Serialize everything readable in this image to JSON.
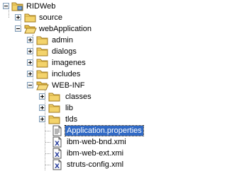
{
  "tree": {
    "root": {
      "label": "RIDWeb",
      "expanded": true,
      "icon": "project-folder-icon"
    },
    "nodes": [
      {
        "label": "source",
        "expanded": false,
        "icon": "folder-icon"
      },
      {
        "label": "webApplication",
        "expanded": true,
        "icon": "open-folder-icon"
      },
      {
        "label": "admin",
        "expanded": false,
        "icon": "folder-icon"
      },
      {
        "label": "dialogs",
        "expanded": false,
        "icon": "folder-icon"
      },
      {
        "label": "imagenes",
        "expanded": false,
        "icon": "folder-icon"
      },
      {
        "label": "includes",
        "expanded": false,
        "icon": "folder-icon"
      },
      {
        "label": "WEB-INF",
        "expanded": true,
        "icon": "open-folder-icon"
      },
      {
        "label": "classes",
        "expanded": false,
        "icon": "folder-icon"
      },
      {
        "label": "lib",
        "expanded": false,
        "icon": "folder-icon"
      },
      {
        "label": "tlds",
        "expanded": false,
        "icon": "folder-icon"
      },
      {
        "label": "Application.properties",
        "selected": true,
        "icon": "properties-file-icon"
      },
      {
        "label": "ibm-web-bnd.xmi",
        "icon": "xmi-file-icon"
      },
      {
        "label": "ibm-web-ext.xmi",
        "icon": "xmi-file-icon"
      },
      {
        "label": "struts-config.xml",
        "icon": "xml-file-icon"
      }
    ]
  },
  "colors": {
    "selection": "#316ac5",
    "folder": "#f3d36b",
    "tree_line": "#9a9a9a"
  }
}
